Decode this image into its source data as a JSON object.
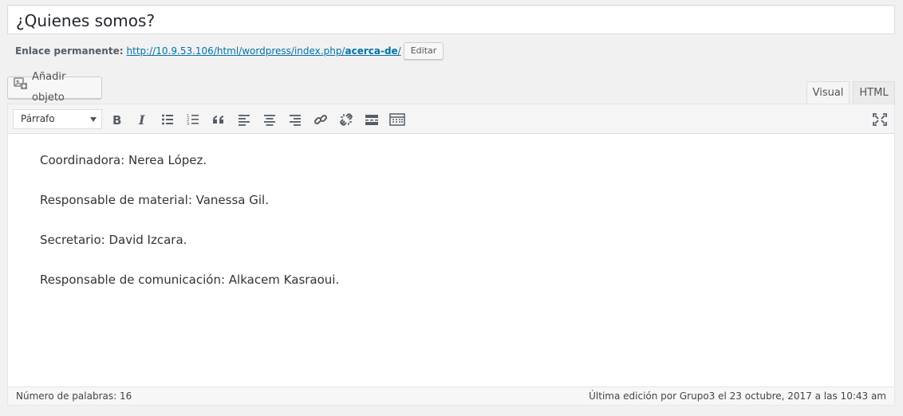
{
  "title": {
    "value": "¿Quienes somos?"
  },
  "permalink": {
    "label": "Enlace permanente:",
    "url_base": "http://10.9.53.106/html/wordpress/index.php/",
    "slug": "acerca-de",
    "url_tail": "/",
    "edit_label": "Editar"
  },
  "media": {
    "add_label": "Añadir objeto",
    "icon": "add-media-icon"
  },
  "tabs": {
    "visual": "Visual",
    "html": "HTML",
    "active": "Visual"
  },
  "toolbar": {
    "format_value": "Párrafo",
    "icons": [
      "bold-icon",
      "italic-icon",
      "bullet-list-icon",
      "numbered-list-icon",
      "blockquote-icon",
      "align-left-icon",
      "align-center-icon",
      "align-right-icon",
      "link-icon",
      "unlink-icon",
      "read-more-icon",
      "toolbar-toggle-icon",
      "fullscreen-icon"
    ]
  },
  "content": {
    "paragraphs": [
      "Coordinadora: Nerea López.",
      "Responsable de material: Vanessa Gil.",
      "Secretario: David Izcara.",
      "Responsable de comunicación: Alkacem Kasraoui."
    ]
  },
  "status": {
    "word_count": "Número de palabras: 16",
    "last_edit": "Última edición por Grupo3 el 23 octubre, 2017 a las 10:43 am"
  },
  "colors": {
    "link": "#0073aa",
    "background": "#f1f1f1"
  }
}
